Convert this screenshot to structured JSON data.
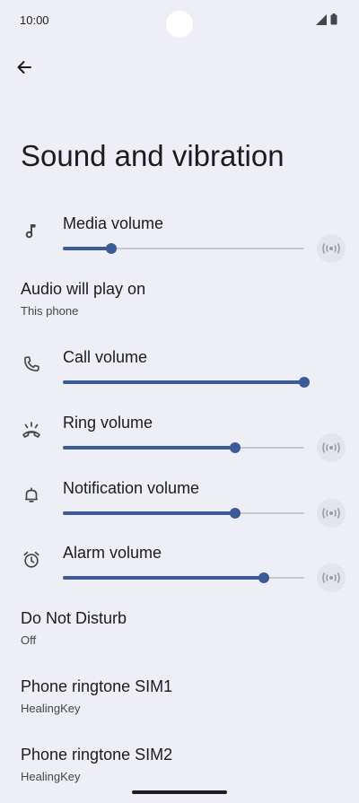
{
  "status_bar": {
    "time": "10:00"
  },
  "page": {
    "title": "Sound and vibration"
  },
  "volumes": [
    {
      "label": "Media volume",
      "icon": "music-note-icon",
      "level": 0.2,
      "vibrate_button": true
    },
    {
      "label": "Call volume",
      "icon": "phone-icon",
      "level": 1.0,
      "vibrate_button": false
    },
    {
      "label": "Ring volume",
      "icon": "ring-icon",
      "level": 0.715,
      "vibrate_button": true
    },
    {
      "label": "Notification volume",
      "icon": "bell-icon",
      "level": 0.715,
      "vibrate_button": true
    },
    {
      "label": "Alarm volume",
      "icon": "alarm-clock-icon",
      "level": 0.833,
      "vibrate_button": true
    }
  ],
  "audio_output": {
    "title": "Audio will play on",
    "value": "This phone"
  },
  "settings": [
    {
      "title": "Do Not Disturb",
      "value": "Off"
    },
    {
      "title": "Phone ringtone SIM1",
      "value": "HealingKey"
    },
    {
      "title": "Phone ringtone SIM2",
      "value": "HealingKey"
    }
  ],
  "colors": {
    "background": "#EDEEF6",
    "accent": "#3C5A95",
    "track": "#C6C7D2"
  }
}
